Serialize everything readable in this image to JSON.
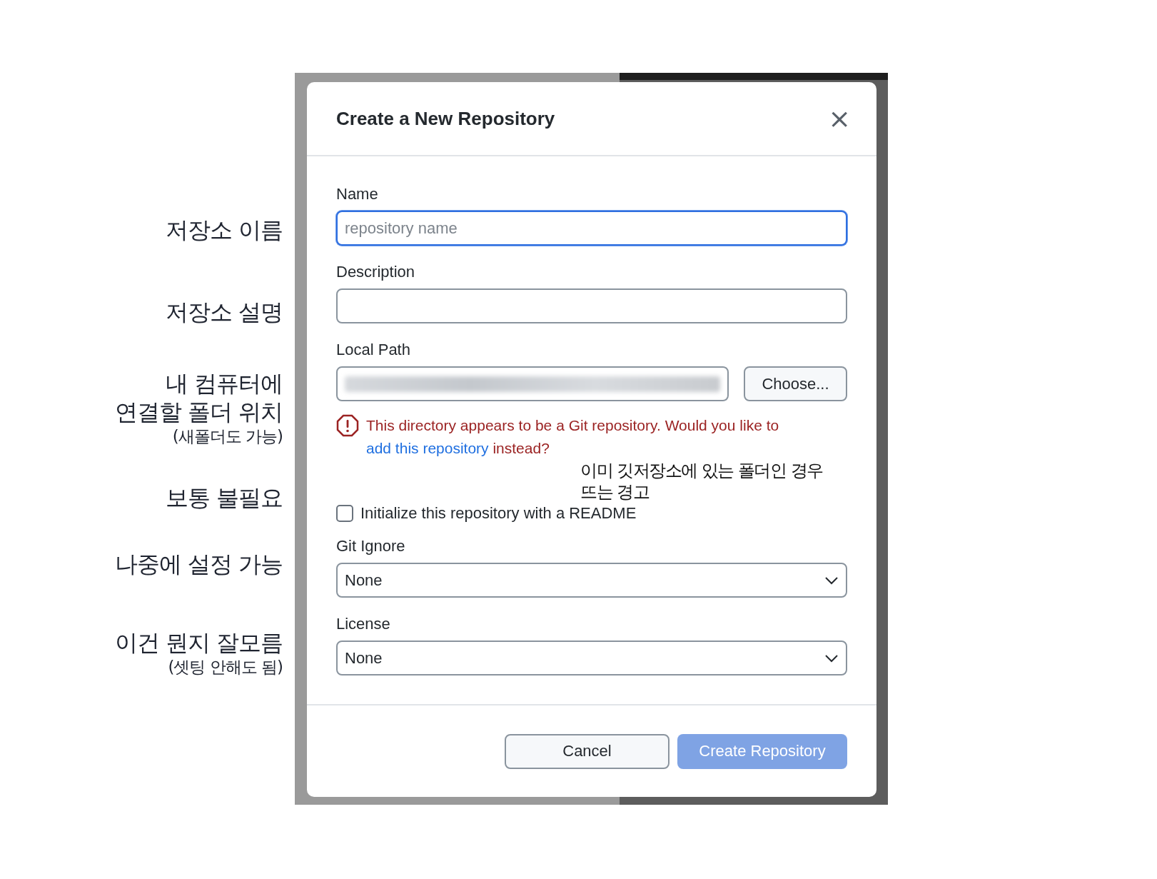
{
  "annotations": [
    {
      "text": "저장소 이름"
    },
    {
      "text": "저장소 설명"
    },
    {
      "text": "내 컴퓨터에 연결할 폴더 위치",
      "note": "(새폴더도 가능)"
    },
    {
      "text": "보통 불필요"
    },
    {
      "text": "나중에 설정 가능"
    },
    {
      "text": "이건 뭔지 잘모름",
      "note": "(셋팅 안해도 됨)"
    }
  ],
  "dialog": {
    "title": "Create a New Repository",
    "close": "×",
    "name": {
      "label": "Name",
      "placeholder": "repository name",
      "focused": true
    },
    "description": {
      "label": "Description"
    },
    "local_path": {
      "label": "Local Path",
      "button": "Choose..."
    },
    "warning": {
      "before": "This directory appears to be a Git repository. Would you like to ",
      "link": "add this repository",
      "after": " instead?",
      "annotation": "이미 깃저장소에 있는 폴더인 경우 뜨는 경고"
    },
    "readme": {
      "label": "Initialize this repository with a README",
      "checked": false
    },
    "git_ignore": {
      "label": "Git Ignore",
      "value": "None"
    },
    "license": {
      "label": "License",
      "value": "None"
    },
    "buttons": [
      {
        "label": "Cancel",
        "kind": "secondary",
        "disabled": false
      },
      {
        "label": "Create Repository",
        "kind": "primary",
        "disabled": true
      }
    ]
  }
}
